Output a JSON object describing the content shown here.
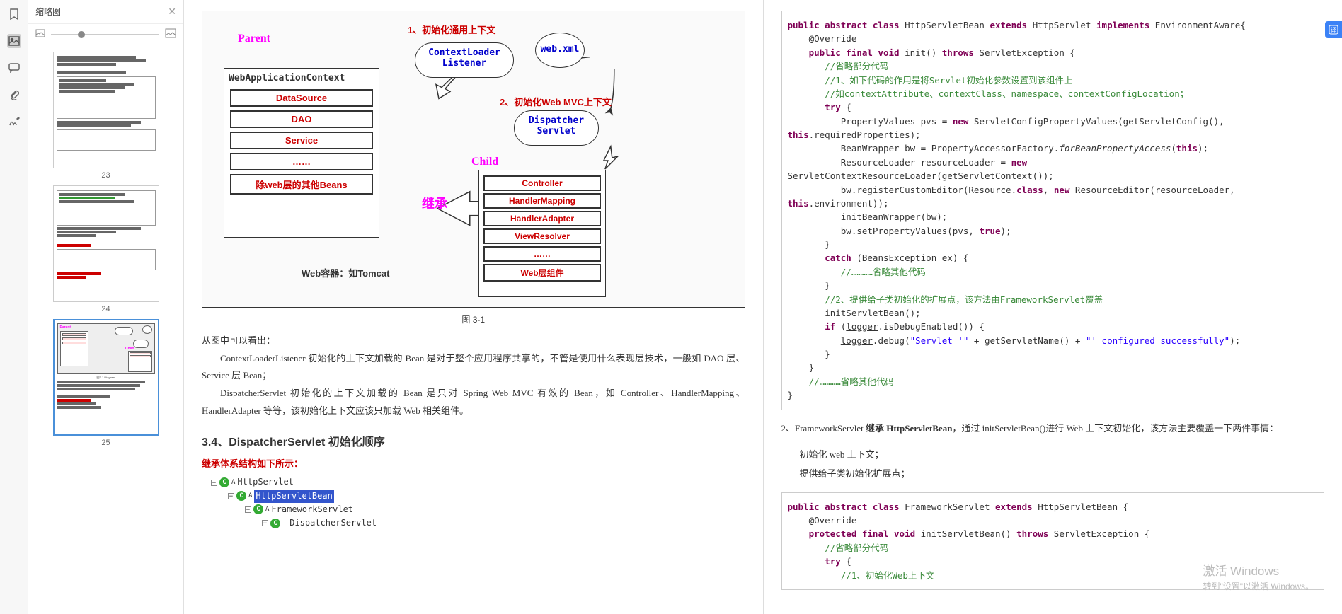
{
  "sidebar": {
    "title": "缩略图",
    "thumbs": [
      {
        "label": "23"
      },
      {
        "label": "24"
      },
      {
        "label": "25"
      }
    ]
  },
  "diagram": {
    "parent_label": "Parent",
    "child_label": "Child",
    "wac_title": "WebApplicationContext",
    "parent_slots": [
      "DataSource",
      "DAO",
      "Service",
      "……",
      "除web层的其他Beans"
    ],
    "ctx_loader": "ContextLoader\nListener",
    "webxml": "web.xml",
    "dispatcher": "Dispatcher\nServlet",
    "child_slots": [
      "Controller",
      "HandlerMapping",
      "HandlerAdapter",
      "ViewResolver",
      "……",
      "Web层组件"
    ],
    "annot1": "1、初始化通用上下文",
    "annot2": "2、初始化Web MVC上下文",
    "inherit": "继承",
    "container": "Web容器：如Tomcat",
    "caption": "图 3-1"
  },
  "body": {
    "p1": "从图中可以看出：",
    "p2": "ContextLoaderListener 初始化的上下文加载的 Bean 是对于整个应用程序共享的，不管是使用什么表现层技术，一般如 DAO 层、Service 层 Bean；",
    "p3": "DispatcherServlet 初始化的上下文加载的 Bean 是只对 Spring Web MVC 有效的 Bean，如 Controller、HandlerMapping、HandlerAdapter 等等，该初始化上下文应该只加载 Web 相关组件。"
  },
  "section_title": "3.4、DispatcherServlet 初始化顺序",
  "inherit_title": "继承体系结构如下所示：",
  "tree": {
    "n1": "HttpServlet",
    "n2": "HttpServletBean",
    "n3": "FrameworkServlet",
    "n4": "DispatcherServlet"
  },
  "code1": {
    "l1_a": "public abstract class",
    "l1_b": " HttpServletBean ",
    "l1_c": "extends",
    "l1_d": " HttpServlet ",
    "l1_e": "implements",
    "l1_f": " EnvironmentAware{",
    "l2": "    @Override",
    "l3_a": "public final void",
    "l3_b": " init() ",
    "l3_c": "throws",
    "l3_d": " ServletException {",
    "l4": "       //省略部分代码",
    "l5": "       //1、如下代码的作用是将Servlet初始化参数设置到该组件上",
    "l6": "       //如contextAttribute、contextClass、namespace、contextConfigLocation；",
    "l7_a": "       try",
    "l7_b": " {",
    "l8_a": "          PropertyValues pvs = ",
    "l8_b": "new",
    "l8_c": " ServletConfigPropertyValues(getServletConfig(), ",
    "l8d_a": "this",
    "l8d_b": ".requiredProperties);",
    "l9_a": "          BeanWrapper bw = PropertyAccessorFactory.",
    "l9_b": "forBeanPropertyAccess",
    "l9_c": "(",
    "l9_d": "this",
    "l9_e": ");",
    "l10_a": "          ResourceLoader resourceLoader = ",
    "l10_b": "new",
    "l10c": "ServletContextResourceLoader(getServletContext());",
    "l11_a": "          bw.registerCustomEditor(Resource.",
    "l11_b": "class",
    "l11_c": ", ",
    "l11_d": "new",
    "l11_e": " ResourceEditor(resourceLoader, ",
    "l11f_a": "this",
    "l11f_b": ".environment));",
    "l12": "          initBeanWrapper(bw);",
    "l13_a": "          bw.setPropertyValues(pvs, ",
    "l13_b": "true",
    "l13_c": ");",
    "l14": "       }",
    "l15_a": "       catch",
    "l15_b": " (BeansException ex) {",
    "l16": "          //…………省略其他代码",
    "l17": "       }",
    "l18": "       //2、提供给子类初始化的扩展点，该方法由FrameworkServlet覆盖",
    "l19": "       initServletBean();",
    "l20_a": "       if",
    "l20_b": " (",
    "l20_c": "logger",
    "l20_d": ".isDebugEnabled()) {",
    "l21_a": "          ",
    "l21_b": "logger",
    "l21_c": ".debug(",
    "l21_d": "\"Servlet '\"",
    "l21_e": " + getServletName() + ",
    "l21_f": "\"' configured successfully\"",
    "l21_g": ");",
    "l22": "       }",
    "l23": "    }",
    "l24": "    //…………省略其他代码",
    "l25": "}"
  },
  "para2_a": "2、FrameworkServlet ",
  "para2_b": "继承 HttpServletBean",
  "para2_c": "，通过 initServletBean()进行 Web 上下文初始化，该方法主要覆盖一下两件事情：",
  "para2_d": "初始化 web 上下文；",
  "para2_e": "提供给子类初始化扩展点；",
  "code2": {
    "l1_a": "public abstract class",
    "l1_b": " FrameworkServlet ",
    "l1_c": "extends",
    "l1_d": " HttpServletBean {",
    "l2": "    @Override",
    "l3_a": "    protected final void",
    "l3_b": " initServletBean() ",
    "l3_c": "throws",
    "l3_d": " ServletException {",
    "l4": "       //省略部分代码",
    "l5_a": "       try",
    "l5_b": " {",
    "l6": "          //1、初始化Web上下文"
  },
  "watermark": {
    "l1": "激活 Windows",
    "l2": "转到\"设置\"以激活 Windows。"
  }
}
